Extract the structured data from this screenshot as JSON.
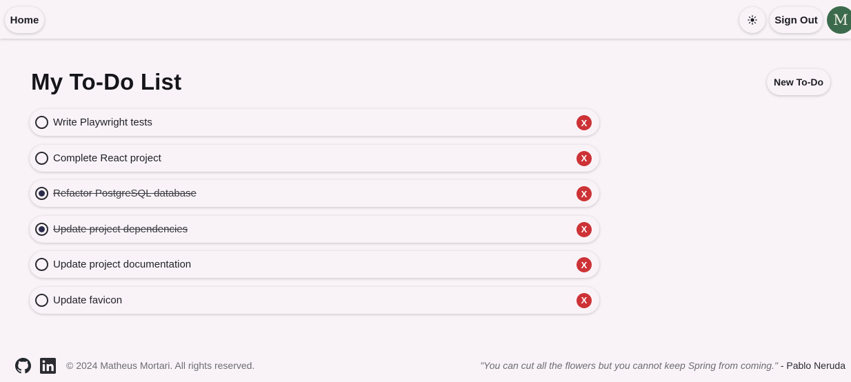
{
  "header": {
    "home_label": "Home",
    "theme_icon": "sun-icon",
    "signout_label": "Sign Out",
    "avatar_initial": "M",
    "avatar_color": "#3c6a4d"
  },
  "main": {
    "title": "My To-Do List",
    "new_todo_label": "New To-Do",
    "todos": [
      {
        "label": "Write Playwright tests",
        "completed": false
      },
      {
        "label": "Complete React project",
        "completed": false
      },
      {
        "label": "Refactor PostgreSQL database",
        "completed": true
      },
      {
        "label": "Update project dependencies",
        "completed": true
      },
      {
        "label": "Update project documentation",
        "completed": false
      },
      {
        "label": "Update favicon",
        "completed": false
      }
    ],
    "delete_glyph": "X",
    "delete_color": "#cc3236"
  },
  "footer": {
    "icons": [
      "github-icon",
      "linkedin-icon"
    ],
    "copyright": "© 2024 Matheus Mortari. All rights reserved.",
    "quote": "\"You can cut all the flowers but you cannot keep Spring from coming.\"",
    "quote_author": " - Pablo Neruda"
  }
}
